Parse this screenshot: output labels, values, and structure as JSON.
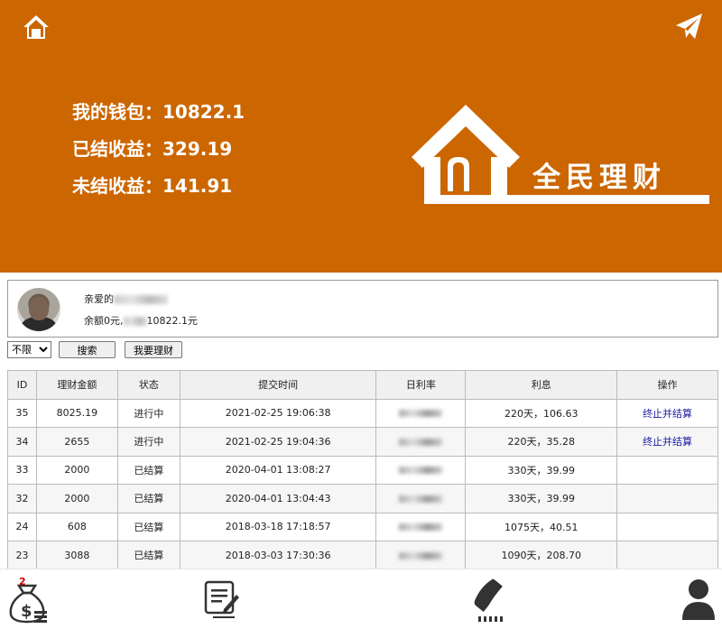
{
  "header": {
    "wallet_label": "我的钱包：10822.1",
    "settled_label": "已结收益：329.19",
    "unsettled_label": "未结收益：141.91",
    "brand_text": "全民理财",
    "bg_color": "#cc6600"
  },
  "user": {
    "greeting": "亲爱的",
    "balance_text_a": "余额0元,",
    "balance_text_b": "10822.1元"
  },
  "filter": {
    "selected": "不限",
    "search_label": "搜索",
    "invest_label": "我要理财"
  },
  "table": {
    "headers": [
      "ID",
      "理财金额",
      "状态",
      "提交时间",
      "日利率",
      "利息",
      "操作"
    ],
    "rows": [
      {
        "id": "35",
        "amount": "8025.19",
        "status": "进行中",
        "time": "2021-02-25 19:06:38",
        "interest": "220天，106.63",
        "action": "终止并结算"
      },
      {
        "id": "34",
        "amount": "2655",
        "status": "进行中",
        "time": "2021-02-25 19:04:36",
        "interest": "220天，35.28",
        "action": "终止并结算"
      },
      {
        "id": "33",
        "amount": "2000",
        "status": "已结算",
        "time": "2020-04-01 13:08:27",
        "interest": "330天，39.99",
        "action": ""
      },
      {
        "id": "32",
        "amount": "2000",
        "status": "已结算",
        "time": "2020-04-01 13:04:43",
        "interest": "330天，39.99",
        "action": ""
      },
      {
        "id": "24",
        "amount": "608",
        "status": "已结算",
        "time": "2018-03-18 17:18:57",
        "interest": "1075天，40.51",
        "action": ""
      },
      {
        "id": "23",
        "amount": "3088",
        "status": "已结算",
        "time": "2018-03-03 17:30:36",
        "interest": "1090天，208.70",
        "action": ""
      }
    ]
  },
  "footer": {
    "badge_count": "2",
    "items": [
      "money-bag-icon",
      "document-edit-icon",
      "phone-icon",
      "user-icon"
    ]
  }
}
